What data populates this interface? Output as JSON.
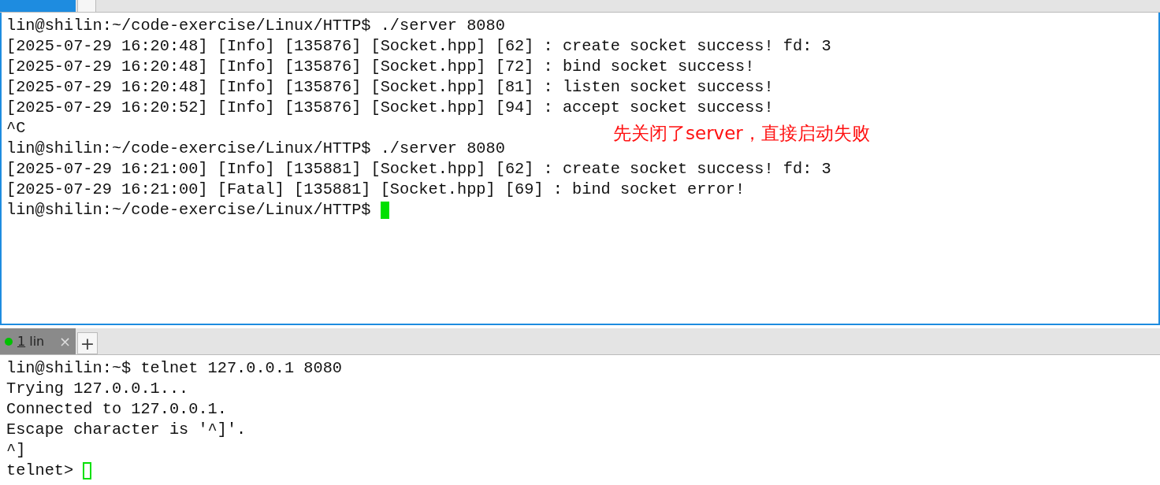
{
  "panes": [
    {
      "tab": {
        "selected": true
      },
      "focused": true,
      "lines": [
        "lin@shilin:~/code-exercise/Linux/HTTP$ ./server 8080",
        "[2025-07-29 16:20:48] [Info] [135876] [Socket.hpp] [62] : create socket success! fd: 3",
        "[2025-07-29 16:20:48] [Info] [135876] [Socket.hpp] [72] : bind socket success!",
        "[2025-07-29 16:20:48] [Info] [135876] [Socket.hpp] [81] : listen socket success!",
        "[2025-07-29 16:20:52] [Info] [135876] [Socket.hpp] [94] : accept socket success!",
        "^C",
        "lin@shilin:~/code-exercise/Linux/HTTP$ ./server 8080",
        "[2025-07-29 16:21:00] [Info] [135881] [Socket.hpp] [62] : create socket success! fd: 3",
        "[2025-07-29 16:21:00] [Fatal] [135881] [Socket.hpp] [69] : bind socket error!",
        "lin@shilin:~/code-exercise/Linux/HTTP$ "
      ],
      "cursor": {
        "filled": true
      },
      "annotation": "先关闭了server，直接启动失败"
    },
    {
      "tab": {
        "selected": false,
        "index": "1",
        "name": "lin",
        "color": "#00c000",
        "close": "×",
        "add": "+"
      },
      "focused": false,
      "lines": [
        "lin@shilin:~$ telnet 127.0.0.1 8080",
        "Trying 127.0.0.1...",
        "Connected to 127.0.0.1.",
        "Escape character is '^]'.",
        "^]",
        "telnet> "
      ],
      "cursor": {
        "filled": false
      }
    }
  ]
}
